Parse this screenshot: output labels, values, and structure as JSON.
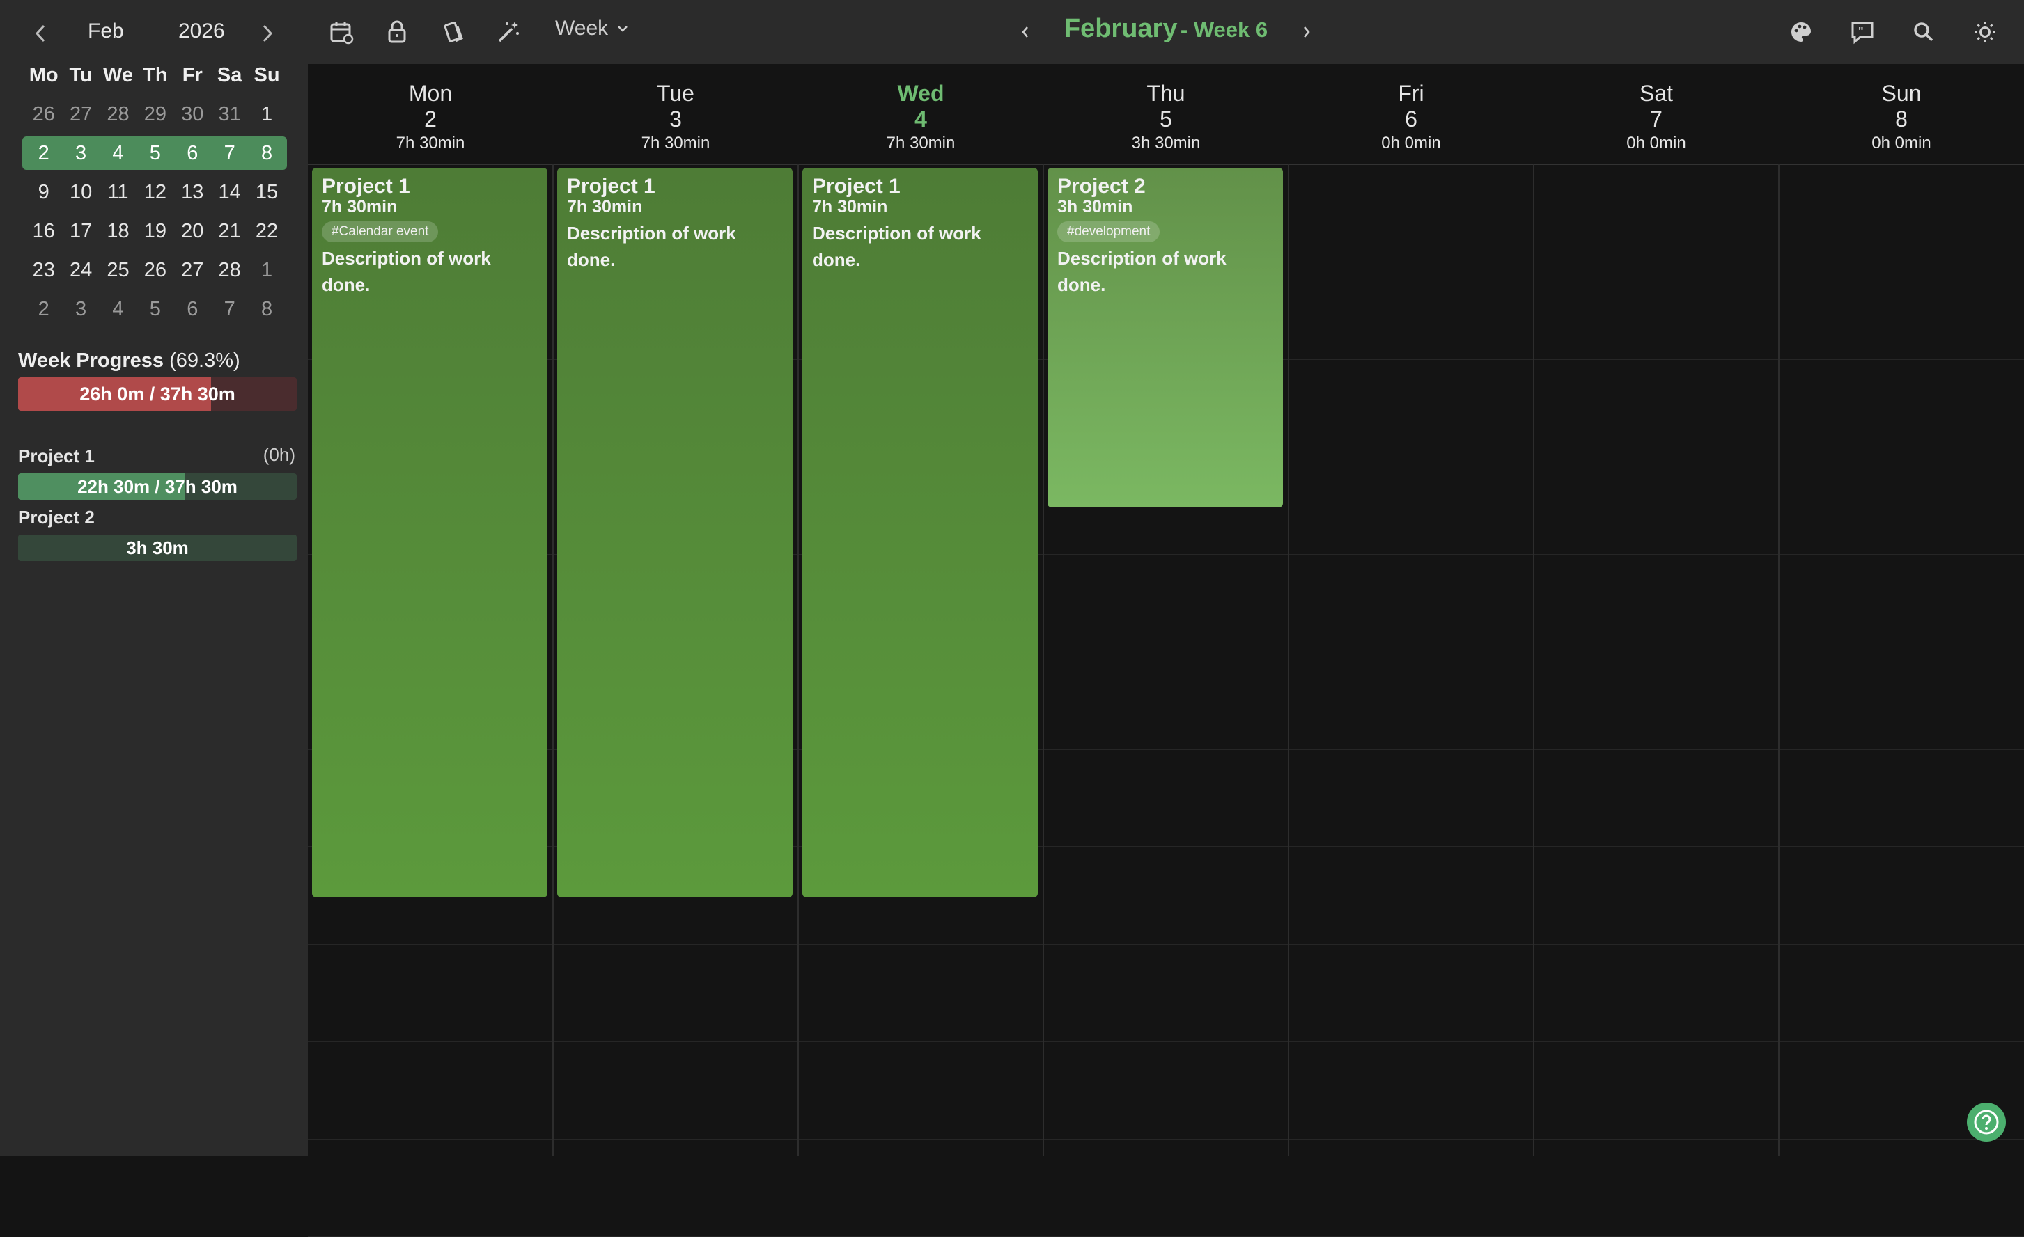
{
  "mini_calendar": {
    "month": "Feb",
    "year": "2026",
    "weekday_headers": [
      "Mo",
      "Tu",
      "We",
      "Th",
      "Fr",
      "Sa",
      "Su"
    ],
    "weeks": [
      [
        {
          "d": "26",
          "o": true
        },
        {
          "d": "27",
          "o": true
        },
        {
          "d": "28",
          "o": true
        },
        {
          "d": "29",
          "o": true
        },
        {
          "d": "30",
          "o": true
        },
        {
          "d": "31",
          "o": true
        },
        {
          "d": "1",
          "o": false
        }
      ],
      [
        {
          "d": "2",
          "o": false
        },
        {
          "d": "3",
          "o": false
        },
        {
          "d": "4",
          "o": false
        },
        {
          "d": "5",
          "o": false
        },
        {
          "d": "6",
          "o": false
        },
        {
          "d": "7",
          "o": false
        },
        {
          "d": "8",
          "o": false
        }
      ],
      [
        {
          "d": "9",
          "o": false
        },
        {
          "d": "10",
          "o": false
        },
        {
          "d": "11",
          "o": false
        },
        {
          "d": "12",
          "o": false
        },
        {
          "d": "13",
          "o": false
        },
        {
          "d": "14",
          "o": false
        },
        {
          "d": "15",
          "o": false
        }
      ],
      [
        {
          "d": "16",
          "o": false
        },
        {
          "d": "17",
          "o": false
        },
        {
          "d": "18",
          "o": false
        },
        {
          "d": "19",
          "o": false
        },
        {
          "d": "20",
          "o": false
        },
        {
          "d": "21",
          "o": false
        },
        {
          "d": "22",
          "o": false
        }
      ],
      [
        {
          "d": "23",
          "o": false
        },
        {
          "d": "24",
          "o": false
        },
        {
          "d": "25",
          "o": false
        },
        {
          "d": "26",
          "o": false
        },
        {
          "d": "27",
          "o": false
        },
        {
          "d": "28",
          "o": false
        },
        {
          "d": "1",
          "o": true
        }
      ],
      [
        {
          "d": "2",
          "o": true
        },
        {
          "d": "3",
          "o": true
        },
        {
          "d": "4",
          "o": true
        },
        {
          "d": "5",
          "o": true
        },
        {
          "d": "6",
          "o": true
        },
        {
          "d": "7",
          "o": true
        },
        {
          "d": "8",
          "o": true
        }
      ]
    ],
    "selected_week_index": 1
  },
  "week_progress": {
    "title": "Week Progress",
    "percent_text": "(69.3%)",
    "bar_text": "26h 0m / 37h 30m",
    "fraction": 0.693,
    "bar_color": "#b04a4a"
  },
  "projects": [
    {
      "name": "Project 1",
      "extra": "(0h)",
      "bar_text": "22h 30m / 37h 30m",
      "fraction": 0.6,
      "color": "#4f8f60"
    },
    {
      "name": "Project 2",
      "extra": "",
      "bar_text": "3h 30m",
      "fraction": 1.0,
      "color": "#34473a"
    }
  ],
  "toolbar": {
    "view_label": "Week",
    "title_month": "February",
    "title_week": "- Week 6",
    "icons": [
      "calendar-icon",
      "lock-icon",
      "tilted-cards-icon",
      "magic-wand-icon",
      "palette-icon",
      "feedback-icon",
      "search-icon",
      "brightness-icon"
    ]
  },
  "days": [
    {
      "name": "Mon",
      "date": "2",
      "hours": "7h 30min",
      "today": false
    },
    {
      "name": "Tue",
      "date": "3",
      "hours": "7h 30min",
      "today": false
    },
    {
      "name": "Wed",
      "date": "4",
      "hours": "7h 30min",
      "today": true
    },
    {
      "name": "Thu",
      "date": "5",
      "hours": "3h 30min",
      "today": false
    },
    {
      "name": "Fri",
      "date": "6",
      "hours": "0h 0min",
      "today": false
    },
    {
      "name": "Sat",
      "date": "7",
      "hours": "0h 0min",
      "today": false
    },
    {
      "name": "Sun",
      "date": "8",
      "hours": "0h 0min",
      "today": false
    }
  ],
  "events": [
    {
      "day": 0,
      "title": "Project 1",
      "hours": "7h 30min",
      "tag": "#Calendar event",
      "desc": "Description of work done.",
      "start": 0,
      "end": 7.5,
      "color_top": "#4e7c36",
      "color_bottom": "#5c9a3c"
    },
    {
      "day": 1,
      "title": "Project 1",
      "hours": "7h 30min",
      "tag": "",
      "desc": "Description of work done.",
      "start": 0,
      "end": 7.5,
      "color_top": "#4e7c36",
      "color_bottom": "#5c9a3c"
    },
    {
      "day": 2,
      "title": "Project 1",
      "hours": "7h 30min",
      "tag": "",
      "desc": "Description of work done.",
      "start": 0,
      "end": 7.5,
      "color_top": "#4e7c36",
      "color_bottom": "#5c9a3c"
    },
    {
      "day": 3,
      "title": "Project 2",
      "hours": "3h 30min",
      "tag": "#development",
      "desc": "Description of work done.",
      "start": 0,
      "end": 3.5,
      "color_top": "#629149",
      "color_bottom": "#7bb862"
    }
  ]
}
